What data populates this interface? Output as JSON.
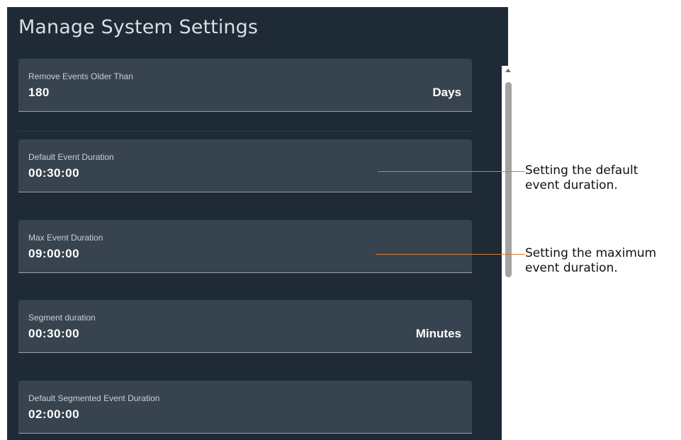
{
  "panel": {
    "title": "Manage System Settings"
  },
  "fields": [
    {
      "label": "Remove Events Older Than",
      "value": "180",
      "unit": "Days"
    },
    {
      "label": "Default Event Duration",
      "value": "00:30:00",
      "unit": ""
    },
    {
      "label": "Max Event Duration",
      "value": "09:00:00",
      "unit": ""
    },
    {
      "label": "Segment duration",
      "value": "00:30:00",
      "unit": "Minutes"
    },
    {
      "label": "Default Segmented Event Duration",
      "value": "02:00:00",
      "unit": ""
    }
  ],
  "callouts": [
    {
      "line1": "Setting the default",
      "line2": "event duration."
    },
    {
      "line1": "Setting the maximum",
      "line2": "event duration."
    }
  ],
  "colors": {
    "panel_bg": "#1e2a35",
    "field_bg": "#37434f",
    "callout_line": "#e07a2c"
  },
  "icons": {
    "scroll_up": "scroll-up-arrow-icon"
  }
}
